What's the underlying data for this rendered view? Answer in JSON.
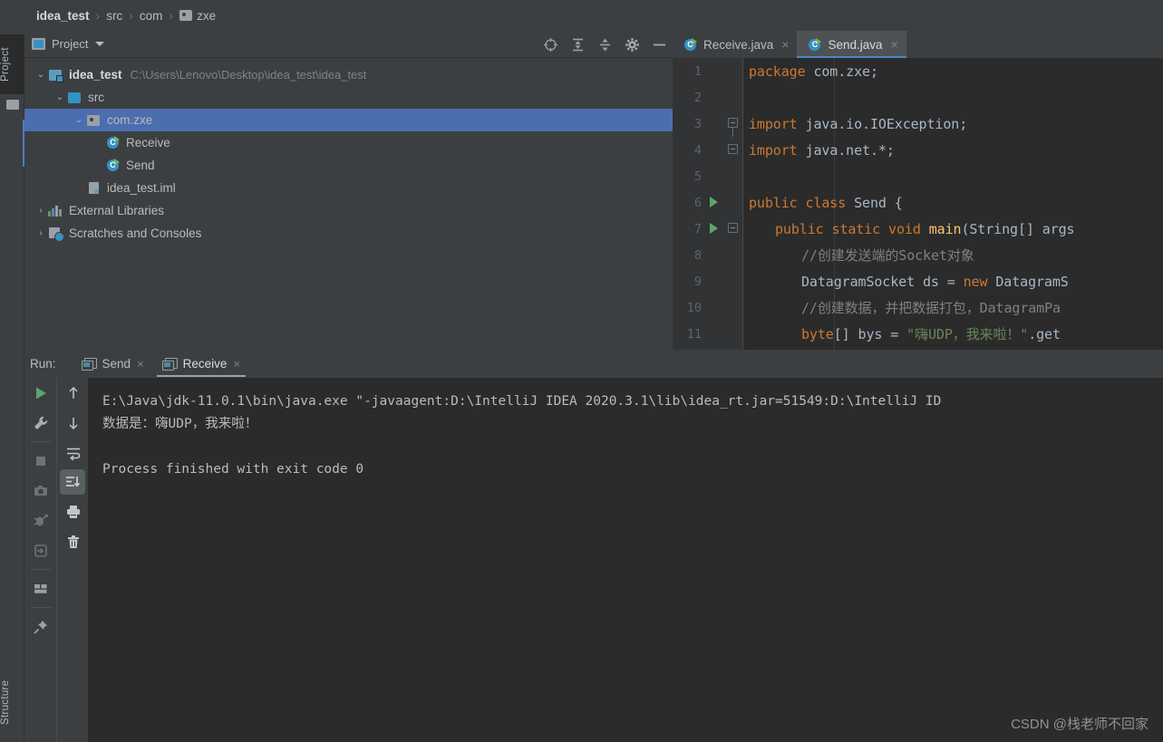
{
  "breadcrumb": {
    "items": [
      {
        "label": "idea_test",
        "bold": true
      },
      {
        "label": "src",
        "bold": false
      },
      {
        "label": "com",
        "bold": false
      },
      {
        "label": "zxe",
        "bold": false,
        "icon": "package-icon"
      }
    ],
    "separator": "›"
  },
  "left_strip": {
    "project_tab": "Project",
    "structure_tab": "Structure"
  },
  "project_panel": {
    "title": "Project",
    "icon": "project-icon",
    "tools": [
      "locate-icon",
      "expand-all-icon",
      "collapse-all-icon",
      "settings-gear-icon",
      "minimize-icon"
    ],
    "tree": [
      {
        "label": "idea_test",
        "path": "C:\\Users\\Lenovo\\Desktop\\idea_test\\idea_test",
        "arrow": "⌄",
        "icon": "module-icon",
        "indent": 0,
        "bold": true,
        "selected": false
      },
      {
        "label": "src",
        "path": "",
        "arrow": "⌄",
        "icon": "source-folder-icon",
        "indent": 1,
        "bold": false,
        "selected": false
      },
      {
        "label": "com.zxe",
        "path": "",
        "arrow": "⌄",
        "icon": "package-icon",
        "indent": 2,
        "bold": false,
        "selected": true
      },
      {
        "label": "Receive",
        "path": "",
        "arrow": "",
        "icon": "java-class-runnable-icon",
        "indent": 3,
        "bold": false,
        "selected": false
      },
      {
        "label": "Send",
        "path": "",
        "arrow": "",
        "icon": "java-class-runnable-icon",
        "indent": 3,
        "bold": false,
        "selected": false
      },
      {
        "label": "idea_test.iml",
        "path": "",
        "arrow": "",
        "icon": "iml-file-icon",
        "indent": 2,
        "bold": false,
        "selected": false
      },
      {
        "label": "External Libraries",
        "path": "",
        "arrow": "›",
        "icon": "libraries-icon",
        "indent": 0,
        "bold": false,
        "selected": false
      },
      {
        "label": "Scratches and Consoles",
        "path": "",
        "arrow": "›",
        "icon": "scratches-icon",
        "indent": 0,
        "bold": false,
        "selected": false
      }
    ]
  },
  "editor": {
    "tabs": [
      {
        "label": "Receive.java",
        "active": false,
        "close": "×",
        "icon": "java-class-runnable-icon"
      },
      {
        "label": "Send.java",
        "active": true,
        "close": "×",
        "icon": "java-class-runnable-icon"
      }
    ],
    "lines": [
      {
        "num": "1",
        "gutter": "",
        "indent": 0,
        "tokens": [
          {
            "t": "package",
            "c": "k"
          },
          {
            "t": " com.zxe;",
            "c": "p"
          }
        ]
      },
      {
        "num": "2",
        "gutter": "",
        "indent": 0,
        "tokens": []
      },
      {
        "num": "3",
        "gutter": "fold-start",
        "indent": 0,
        "tokens": [
          {
            "t": "import",
            "c": "k"
          },
          {
            "t": " java.io.IOException;",
            "c": "p"
          }
        ]
      },
      {
        "num": "4",
        "gutter": "fold-end",
        "indent": 0,
        "tokens": [
          {
            "t": "import",
            "c": "k"
          },
          {
            "t": " java.net.*;",
            "c": "p"
          }
        ]
      },
      {
        "num": "5",
        "gutter": "",
        "indent": 0,
        "tokens": []
      },
      {
        "num": "6",
        "gutter": "run",
        "indent": 0,
        "tokens": [
          {
            "t": "public class",
            "c": "k"
          },
          {
            "t": " Send {",
            "c": "p"
          }
        ]
      },
      {
        "num": "7",
        "gutter": "run-fold",
        "indent": 1,
        "tokens": [
          {
            "t": "public static void",
            "c": "k"
          },
          {
            "t": " ",
            "c": "p"
          },
          {
            "t": "main",
            "c": "fn"
          },
          {
            "t": "(String[] args",
            "c": "p"
          }
        ]
      },
      {
        "num": "8",
        "gutter": "",
        "indent": 2,
        "tokens": [
          {
            "t": "//创建发送端的Socket对象",
            "c": "cm"
          }
        ]
      },
      {
        "num": "9",
        "gutter": "",
        "indent": 2,
        "tokens": [
          {
            "t": "DatagramSocket ds = ",
            "c": "p"
          },
          {
            "t": "new",
            "c": "k"
          },
          {
            "t": " DatagramS",
            "c": "p"
          }
        ]
      },
      {
        "num": "10",
        "gutter": "",
        "indent": 2,
        "tokens": [
          {
            "t": "//创建数据，并把数据打包，DatagramPa",
            "c": "cm"
          }
        ]
      },
      {
        "num": "11",
        "gutter": "",
        "indent": 2,
        "tokens": [
          {
            "t": "byte",
            "c": "k"
          },
          {
            "t": "[] bys = ",
            "c": "p"
          },
          {
            "t": "\"嗨UDP，我来啦！\"",
            "c": "st"
          },
          {
            "t": ".get",
            "c": "p"
          }
        ]
      }
    ]
  },
  "run_panel": {
    "label": "Run:",
    "tabs": [
      {
        "label": "Send",
        "active": false,
        "close": "×",
        "icon": "console-icon"
      },
      {
        "label": "Receive",
        "active": true,
        "close": "×",
        "icon": "console-icon"
      }
    ],
    "toolbar_left": [
      "run-icon",
      "wrench-icon",
      "stop-icon",
      "camera-icon",
      "debug-icon",
      "export-icon",
      "layout-icon",
      "pin-icon"
    ],
    "toolbar_right": [
      "scroll-up-icon",
      "scroll-down-icon",
      "soft-wrap-icon",
      "scroll-to-end-icon",
      "print-icon",
      "trash-icon"
    ],
    "console_lines": [
      "E:\\Java\\jdk-11.0.1\\bin\\java.exe \"-javaagent:D:\\IntelliJ IDEA 2020.3.1\\lib\\idea_rt.jar=51549:D:\\IntelliJ ID",
      "数据是：嗨UDP，我来啦！",
      "",
      "Process finished with exit code 0"
    ]
  },
  "watermark": "CSDN @栈老师不回家",
  "colors": {
    "bg_panel": "#3c3f41",
    "bg_editor": "#2b2b2b",
    "selection": "#4b6eaf",
    "accent_blue": "#3592c4",
    "keyword_orange": "#cc7832",
    "string_green": "#6a8759",
    "comment_gray": "#808080",
    "method_yellow": "#ffc66d",
    "run_green": "#59a869",
    "text": "#bbbbbb"
  }
}
